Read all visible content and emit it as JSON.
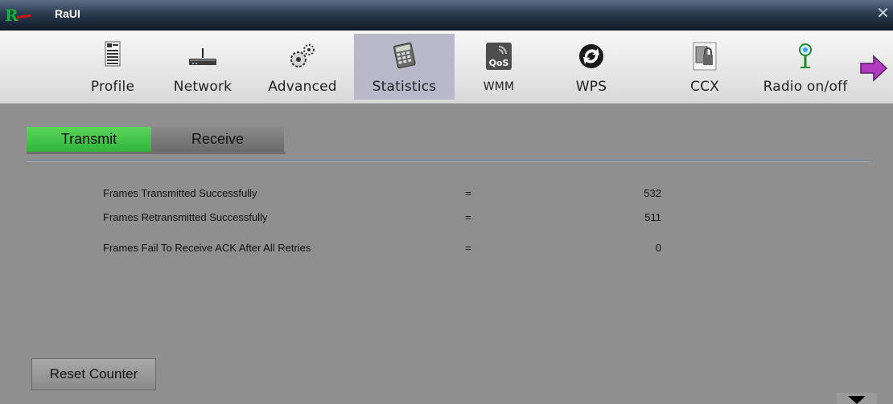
{
  "window": {
    "title": "RaUI",
    "close_glyph": "✕"
  },
  "toolbar": {
    "items": [
      {
        "label": "Profile",
        "icon": "profile-icon",
        "active": false
      },
      {
        "label": "Network",
        "icon": "network-icon",
        "active": false
      },
      {
        "label": "Advanced",
        "icon": "advanced-icon",
        "active": false
      },
      {
        "label": "Statistics",
        "icon": "statistics-icon",
        "active": true
      },
      {
        "label": "WMM",
        "icon": "wmm-qos-icon",
        "active": false
      },
      {
        "label": "WPS",
        "icon": "wps-icon",
        "active": false
      },
      {
        "label": "CCX",
        "icon": "ccx-icon",
        "active": false
      },
      {
        "label": "Radio on/off",
        "icon": "radio-icon",
        "active": false
      }
    ],
    "next_icon": "next-arrow-icon"
  },
  "statistics": {
    "tabs": {
      "transmit": "Transmit",
      "receive": "Receive",
      "selected": "Transmit"
    },
    "rows": [
      {
        "label": "Frames Transmitted Successfully",
        "eq": "=",
        "value": "532"
      },
      {
        "label": "Frames Retransmitted Successfully",
        "eq": "=",
        "value": "511"
      },
      {
        "label": "Frames Fail To Receive ACK After All Retries",
        "eq": "=",
        "value": "0"
      }
    ],
    "reset_label": "Reset Counter"
  },
  "colors": {
    "active_tab": "#3fc145",
    "toolbar_active": "#b9b8c8",
    "panel_bg": "#8f8f8f",
    "titlebar": "#1f2d3d"
  }
}
